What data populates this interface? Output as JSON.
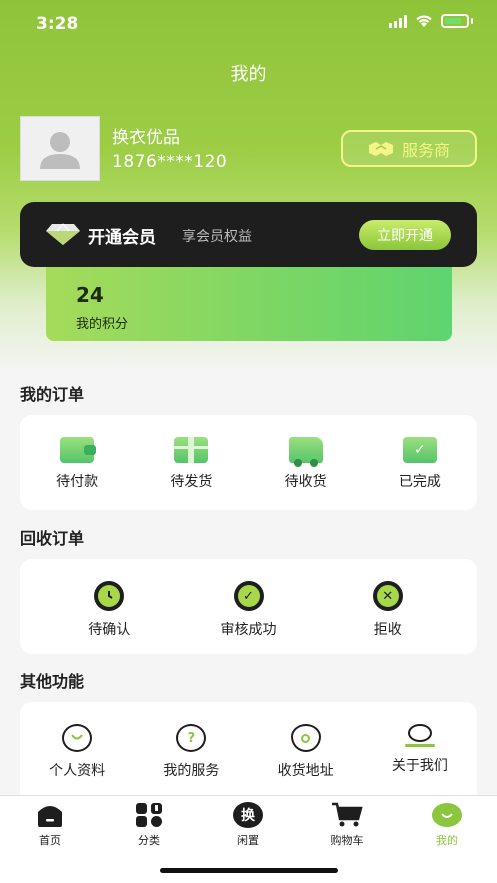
{
  "status": {
    "time": "3:28"
  },
  "header": {
    "title": "我的"
  },
  "user": {
    "name": "换衣优品",
    "phone": "1876****120"
  },
  "provider_button": {
    "label": "服务商"
  },
  "vip": {
    "title": "开通会员",
    "subtitle": "享会员权益",
    "button": "立即开通"
  },
  "points": {
    "value": "24",
    "label": "我的积分"
  },
  "orders": {
    "title": "我的订单",
    "items": [
      {
        "label": "待付款",
        "icon": "wallet-icon"
      },
      {
        "label": "待发货",
        "icon": "package-icon"
      },
      {
        "label": "待收货",
        "icon": "truck-icon"
      },
      {
        "label": "已完成",
        "icon": "clipboard-check-icon"
      }
    ]
  },
  "recycle": {
    "title": "回收订单",
    "items": [
      {
        "label": "待确认",
        "icon": "clock-icon"
      },
      {
        "label": "审核成功",
        "icon": "check-icon"
      },
      {
        "label": "拒收",
        "icon": "x-icon"
      }
    ]
  },
  "other": {
    "title": "其他功能",
    "items": [
      {
        "label": "个人资料",
        "icon": "profile-icon"
      },
      {
        "label": "我的服务",
        "icon": "help-icon"
      },
      {
        "label": "收货地址",
        "icon": "location-icon"
      },
      {
        "label": "关于我们",
        "icon": "about-icon"
      }
    ]
  },
  "tabbar": {
    "items": [
      {
        "label": "首页",
        "icon": "home-icon"
      },
      {
        "label": "分类",
        "icon": "category-icon"
      },
      {
        "label": "闲置",
        "icon": "exchange-icon",
        "glyph": "换"
      },
      {
        "label": "购物车",
        "icon": "cart-icon"
      },
      {
        "label": "我的",
        "icon": "me-icon",
        "active": true
      }
    ]
  },
  "colors": {
    "brand": "#8cc63f",
    "dark": "#1e1e1e",
    "accent_yellow": "#f3f58a"
  }
}
